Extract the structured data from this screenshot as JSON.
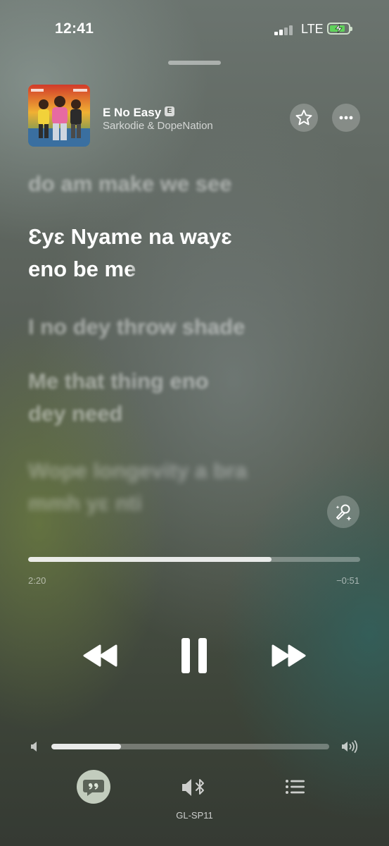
{
  "status_bar": {
    "time": "12:41",
    "network": "LTE",
    "battery_level": 0.85
  },
  "now_playing": {
    "title": "E No Easy",
    "explicit_badge": "E",
    "artist": "Sarkodie & DopeNation",
    "artwork_icon": "album-artwork"
  },
  "lyrics": {
    "previous": [
      "do am make we see"
    ],
    "current": {
      "line1": "Ɛyɛ Nyame na wayɛ",
      "line2_sung": "eno be m",
      "line2_unsung": "e"
    },
    "upcoming": [
      "I no dey throw shade",
      "Me that thing eno",
      "dey need",
      "Wope longevity a bra",
      "mmh yɛ nti"
    ]
  },
  "playback": {
    "elapsed": "2:20",
    "remaining": "−0:51",
    "progress": 0.733,
    "state": "playing"
  },
  "volume": {
    "level": 0.25
  },
  "output": {
    "device_name": "GL-SP11"
  },
  "icons": {
    "star": "star-icon",
    "more": "ellipsis-icon",
    "mic": "sing-mic-icon",
    "rewind": "rewind-icon",
    "pause": "pause-icon",
    "forward": "fast-forward-icon",
    "lyrics": "lyrics-quote-icon",
    "speaker": "speaker-bluetooth-icon",
    "queue": "queue-list-icon"
  },
  "colors": {
    "active_lyric": "#ffffff",
    "battery_fill": "#5fd35a"
  }
}
